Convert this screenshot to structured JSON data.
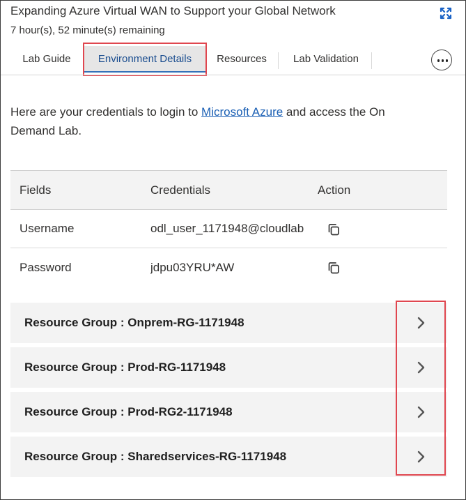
{
  "header": {
    "title": "Expanding Azure Virtual WAN to Support your Global Network",
    "remaining": "7 hour(s), 52 minute(s) remaining",
    "expand_icon": "expand-icon"
  },
  "tabs": [
    {
      "label": "Lab Guide",
      "active": false
    },
    {
      "label": "Environment Details",
      "active": true
    },
    {
      "label": "Resources",
      "active": false
    },
    {
      "label": "Lab Validation",
      "active": false
    }
  ],
  "more_icon": "more-options-icon",
  "intro": {
    "before": "Here are your credentials to login to ",
    "link": "Microsoft Azure",
    "after": " and access the On Demand Lab."
  },
  "credentials": {
    "headers": [
      "Fields",
      "Credentials",
      "Action"
    ],
    "rows": [
      {
        "field": "Username",
        "value": "odl_user_1171948@cloudlab",
        "action_icon": "copy-icon"
      },
      {
        "field": "Password",
        "value": "jdpu03YRU*AW",
        "action_icon": "copy-icon"
      }
    ]
  },
  "resource_groups": [
    {
      "label": "Resource Group : Onprem-RG-1171948"
    },
    {
      "label": "Resource Group : Prod-RG-1171948"
    },
    {
      "label": "Resource Group : Prod-RG2-1171948"
    },
    {
      "label": "Resource Group : Sharedservices-RG-1171948"
    }
  ],
  "colors": {
    "highlight": "#e0464f",
    "link": "#1a5fb4",
    "active_tab_text": "#1a4d8f",
    "row_background": "#f3f3f3"
  }
}
